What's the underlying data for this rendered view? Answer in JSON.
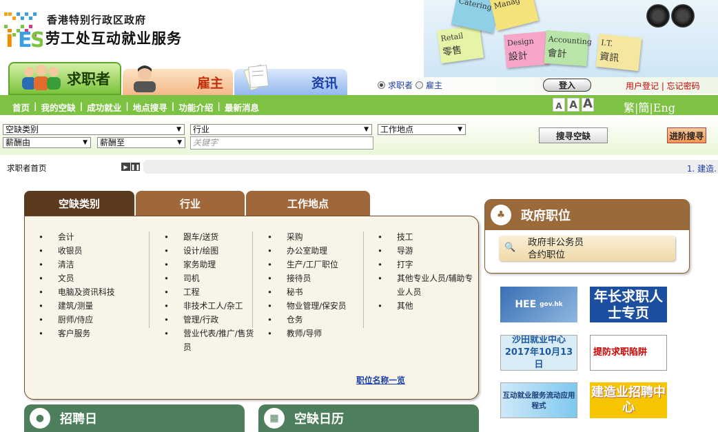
{
  "header": {
    "org_line1": "香港特别行政区政府",
    "org_line2": "劳工处互动就业服务",
    "banner_notes": [
      {
        "en": "Retail",
        "zh": "零售",
        "color": "#e6f4a8"
      },
      {
        "en": "Design",
        "zh": "設計",
        "color": "#f7a6c9"
      },
      {
        "en": "Accounting",
        "zh": "會計",
        "color": "#b9e5a8"
      },
      {
        "en": "I.T.",
        "zh": "資訊",
        "color": "#f6e7a0"
      },
      {
        "en": "Catering",
        "zh": "",
        "color": "#8fd0e6"
      },
      {
        "en": "Manag",
        "zh": "",
        "color": "#f4e27a"
      }
    ]
  },
  "tabs": {
    "seeker": "求职者",
    "employer": "雇主",
    "info": "资讯"
  },
  "role": {
    "seeker": "求职者",
    "employer": "雇主",
    "login": "登入",
    "register": "用户登记 | 忘记密码"
  },
  "nav": {
    "items": [
      "首页",
      "我的空缺",
      "成功就业",
      "地点搜寻",
      "功能介绍",
      "最新消息"
    ],
    "font_sizes": [
      "A",
      "A",
      "A"
    ],
    "lang": "繁|簡|Eng"
  },
  "search": {
    "vacancy_type": "空缺类别",
    "industry": "行业",
    "location": "工作地点",
    "salary_from": "薪酬由",
    "salary_to": "薪酬至",
    "keyword_placeholder": "关键字",
    "search_button": "搜寻空缺",
    "advanced_button": "进阶搜寻"
  },
  "breadcrumb": {
    "current": "求职者首页",
    "ticker": "1. 建造."
  },
  "categories": {
    "tabs": [
      "空缺类别",
      "行业",
      "工作地点"
    ],
    "col1": [
      "会计",
      "收银员",
      "清洁",
      "文员",
      "电脑及资讯科技",
      "建筑/测量",
      "厨师/侍应",
      "客户服务"
    ],
    "col2": [
      "跟车/送货",
      "设计/绘图",
      "家务助理",
      "司机",
      "工程",
      "非技术工人/杂工",
      "管理/行政",
      "营业代表/推广/售货员"
    ],
    "col3": [
      "采购",
      "办公室助理",
      "生产/工厂职位",
      "接待员",
      "秘书",
      "物业管理/保安员",
      "仓务",
      "教师/导师"
    ],
    "col4": [
      "技工",
      "导游",
      "打字",
      "其他专业人员/辅助专业人员",
      "其他"
    ],
    "full_list": "职位名称一览"
  },
  "gov": {
    "title": "政府职位",
    "link_line1": "政府非公务员",
    "link_line2": "合约职位"
  },
  "promos": {
    "hee": "HEE",
    "hee_sub": "gov.hk",
    "elderly": "年长求职人士专页",
    "shatin_line1": "沙田就业中心",
    "shatin_line2": "2017年10月13日",
    "trap": "提防求职陷阱",
    "app": "互动就业服务流动应用程式",
    "construction": "建造业招聘中心"
  },
  "panels": {
    "job_fair": "招聘日",
    "vacancy_calendar": "空缺日历"
  }
}
